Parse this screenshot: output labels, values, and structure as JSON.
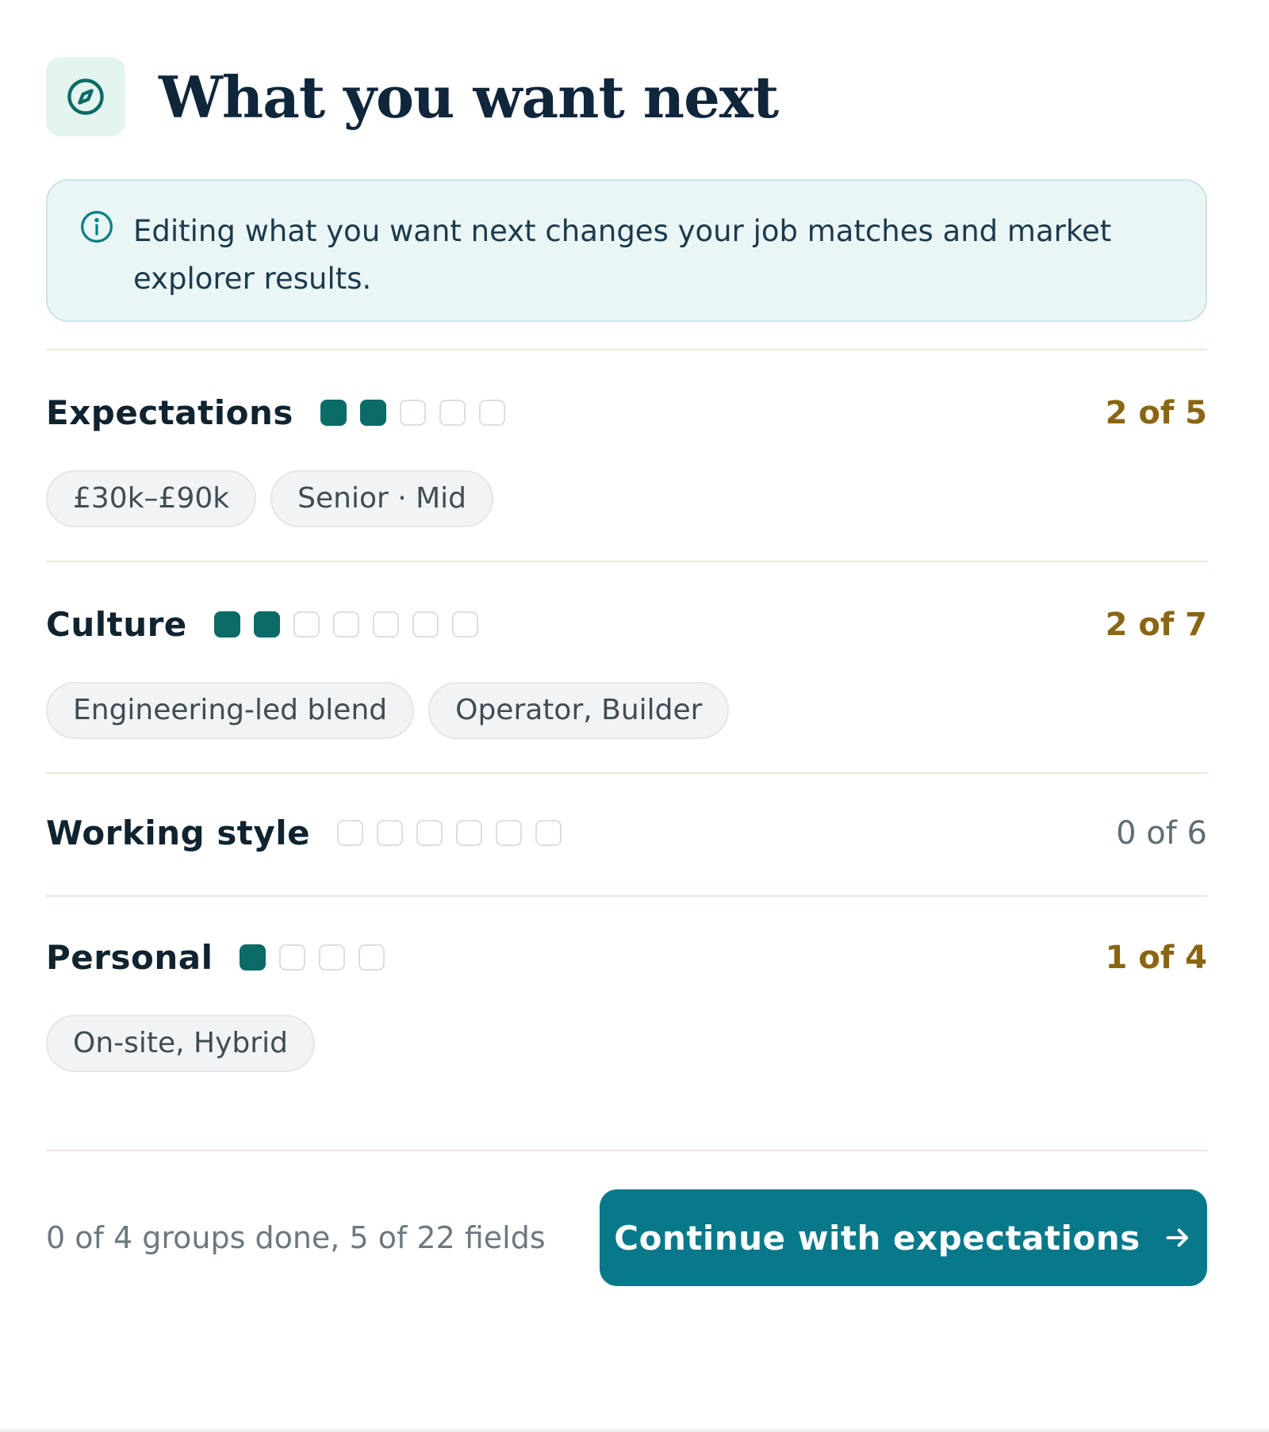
{
  "header": {
    "title": "What you want next",
    "icon": "compass-icon",
    "icon_color": "#0b6b66"
  },
  "notice": {
    "icon": "info-icon",
    "text": "Editing what you want next changes your job matches and market explorer results."
  },
  "colors": {
    "filled_dot": "#0b6b66",
    "count_active": "#8a6512",
    "button": "#08798a"
  },
  "groups": [
    {
      "title": "Expectations",
      "filled": 2,
      "total": 5,
      "count_label": "2 of 5",
      "chips": [
        "£30k–£90k",
        "Senior · Mid"
      ]
    },
    {
      "title": "Culture",
      "filled": 2,
      "total": 7,
      "count_label": "2 of 7",
      "chips": [
        "Engineering-led blend",
        "Operator, Builder"
      ]
    },
    {
      "title": "Working style",
      "filled": 0,
      "total": 6,
      "count_label": "0 of 6",
      "chips": []
    },
    {
      "title": "Personal",
      "filled": 1,
      "total": 4,
      "count_label": "1 of 4",
      "chips": [
        "On-site, Hybrid"
      ]
    }
  ],
  "footer": {
    "status": "0 of 4 groups done, 5 of 22 fields",
    "button_label": "Continue with expectations",
    "button_icon": "arrow-right-icon"
  }
}
